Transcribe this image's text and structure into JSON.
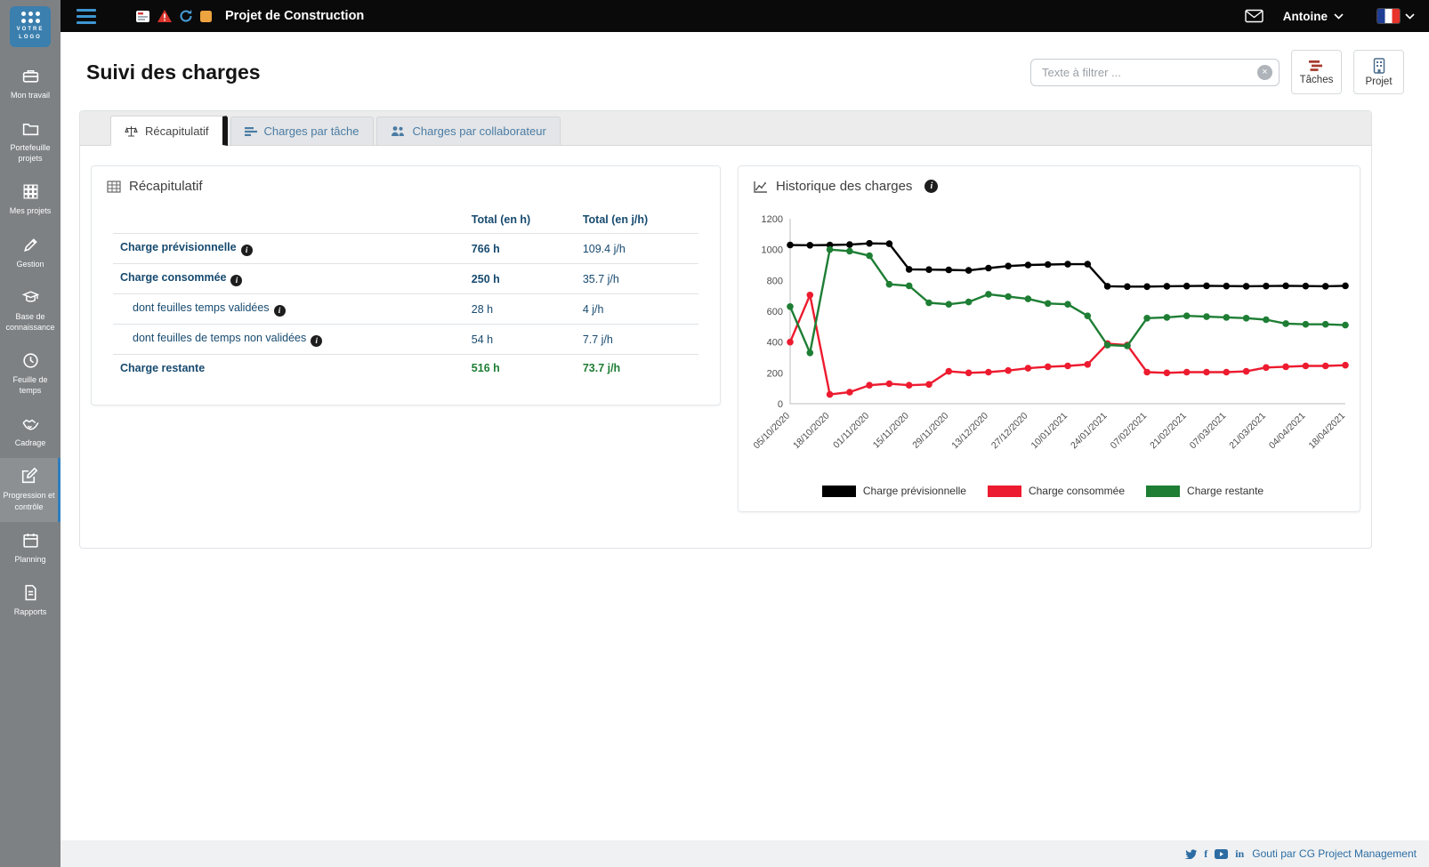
{
  "brand": {
    "logo_line1": "VOTRE",
    "logo_line2": "LOGO"
  },
  "colors": {
    "accent_blue": "#3e96d2",
    "navy": "#174a6f",
    "green": "#1e7e34",
    "red": "#ed1b2f",
    "black": "#000000",
    "sidebar_gray": "#7e8184"
  },
  "topbar": {
    "project_title": "Projet de Construction",
    "user_name": "Antoine",
    "icons": [
      "deliverable-board-icon",
      "risk-warning-icon",
      "action-sync-icon",
      "milestone-icon",
      "mail-icon",
      "france-flag-icon"
    ]
  },
  "sidebar": {
    "items": [
      {
        "label": "Mon travail",
        "icon": "briefcase-icon",
        "active": false
      },
      {
        "label": "Portefeuille projets",
        "icon": "folder-icon",
        "active": false
      },
      {
        "label": "Mes projets",
        "icon": "grid-icon",
        "active": false
      },
      {
        "label": "Gestion",
        "icon": "pencil-icon",
        "active": false
      },
      {
        "label": "Base de connaissance",
        "icon": "graduation-cap-icon",
        "active": false
      },
      {
        "label": "Feuille de temps",
        "icon": "clock-icon",
        "active": false
      },
      {
        "label": "Cadrage",
        "icon": "handshake-icon",
        "active": false
      },
      {
        "label": "Progression et contrôle",
        "icon": "edit-icon",
        "active": true
      },
      {
        "label": "Planning",
        "icon": "calendar-icon",
        "active": false
      },
      {
        "label": "Rapports",
        "icon": "report-icon",
        "active": false
      }
    ]
  },
  "page": {
    "title": "Suivi des charges",
    "search_placeholder": "Texte à filtrer ...",
    "buttons": {
      "tasks": "Tâches",
      "project": "Projet"
    }
  },
  "tabs": [
    {
      "label": "Récapitulatif",
      "icon": "scale-icon",
      "active": true
    },
    {
      "label": "Charges par tâche",
      "icon": "task-bars-icon",
      "active": false
    },
    {
      "label": "Charges par collaborateur",
      "icon": "people-icon",
      "active": false
    }
  ],
  "recap": {
    "title": "Récapitulatif",
    "columns": {
      "h": "Total (en h)",
      "jh": "Total (en j/h)"
    },
    "rows": [
      {
        "label": "Charge prévisionnelle",
        "h": "766 h",
        "jh": "109.4 j/h"
      },
      {
        "label": "Charge consommée",
        "h": "250 h",
        "jh": "35.7 j/h"
      },
      {
        "label": "dont feuilles temps validées",
        "h": "28 h",
        "jh": "4 j/h"
      },
      {
        "label": "dont feuilles de temps non validées",
        "h": "54 h",
        "jh": "7.7 j/h"
      },
      {
        "label": "Charge restante",
        "h": "516 h",
        "jh": "73.7 j/h"
      }
    ]
  },
  "history": {
    "title": "Historique des charges"
  },
  "chart_data": {
    "type": "line",
    "title": "Historique des charges",
    "x_labels": [
      "05/10/2020",
      "18/10/2020",
      "01/11/2020",
      "15/11/2020",
      "29/11/2020",
      "13/12/2020",
      "27/12/2020",
      "10/01/2021",
      "24/01/2021",
      "07/02/2021",
      "21/02/2021",
      "07/03/2021",
      "21/03/2021",
      "04/04/2021",
      "18/04/2021"
    ],
    "label_every": 2,
    "ylim": [
      0,
      1200
    ],
    "y_ticks": [
      0,
      200,
      400,
      600,
      800,
      1000,
      1200
    ],
    "grid": false,
    "legend_position": "bottom",
    "series": [
      {
        "name": "Charge prévisionnelle",
        "color": "#000000",
        "values": [
          1030,
          1028,
          1030,
          1032,
          1040,
          1038,
          872,
          870,
          868,
          865,
          880,
          893,
          900,
          903,
          905,
          905,
          762,
          760,
          760,
          762,
          763,
          765,
          763,
          762,
          763,
          765,
          763,
          762,
          765
        ]
      },
      {
        "name": "Charge consommée",
        "color": "#ed1b2f",
        "values": [
          400,
          705,
          60,
          75,
          120,
          130,
          120,
          125,
          210,
          200,
          205,
          215,
          230,
          240,
          245,
          255,
          390,
          380,
          205,
          200,
          205,
          205,
          205,
          210,
          235,
          240,
          245,
          245,
          250
        ]
      },
      {
        "name": "Charge restante",
        "color": "#1e7e34",
        "values": [
          630,
          330,
          1000,
          990,
          960,
          775,
          765,
          655,
          645,
          660,
          710,
          695,
          680,
          650,
          645,
          570,
          380,
          375,
          555,
          560,
          570,
          565,
          560,
          555,
          545,
          520,
          515,
          515,
          510
        ]
      }
    ]
  },
  "footer": {
    "text": "Gouti par CG Project Management",
    "social": [
      "twitter-icon",
      "facebook-icon",
      "youtube-icon",
      "linkedin-icon"
    ]
  }
}
